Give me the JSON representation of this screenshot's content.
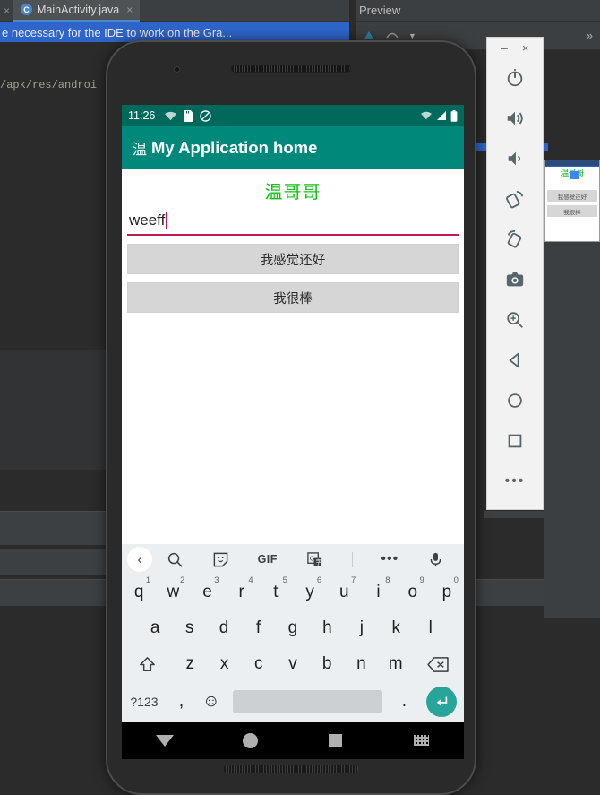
{
  "ide": {
    "tab_label": "MainActivity.java",
    "tab_icon": "class-java-icon",
    "tab_close": "×",
    "tab_close_left": "×",
    "preview_panel_title": "Preview",
    "overflow_label": "»",
    "highlighted_line": "e necessary for the IDE to work on the Gra...",
    "resource_path": "/apk/res/androi"
  },
  "mini_preview": {
    "green_text": "温哥哥",
    "button1": "我感觉还好",
    "button2": "我很棒"
  },
  "emulator_toolbar": {
    "minimize": "–",
    "close": "×",
    "buttons": [
      {
        "name": "power-icon",
        "label": "Power"
      },
      {
        "name": "volume-up-icon",
        "label": "Volume Up"
      },
      {
        "name": "volume-down-icon",
        "label": "Volume Down"
      },
      {
        "name": "rotate-left-icon",
        "label": "Rotate Left"
      },
      {
        "name": "rotate-right-icon",
        "label": "Rotate Right"
      },
      {
        "name": "screenshot-camera-icon",
        "label": "Take Screenshot"
      },
      {
        "name": "zoom-in-icon",
        "label": "Zoom"
      },
      {
        "name": "back-icon",
        "label": "Back"
      },
      {
        "name": "home-icon",
        "label": "Home"
      },
      {
        "name": "overview-icon",
        "label": "Overview"
      }
    ],
    "more_label": "•••"
  },
  "phone": {
    "statusbar": {
      "time": "11:26",
      "left_icons": [
        "wifi-off-icon",
        "sd-card-icon",
        "do-not-disturb-icon"
      ],
      "right_icons": [
        "wifi-off-icon",
        "signal-icon",
        "battery-icon"
      ]
    },
    "appbar": {
      "cn_prefix": "温",
      "title": "My Application home"
    },
    "content": {
      "green_text": "温哥哥",
      "input_value": "weeff",
      "input_placeholder": "",
      "button1": "我感觉还好",
      "button2": "我很棒"
    },
    "keyboard": {
      "toolbar": {
        "back": "‹",
        "search": "search-icon",
        "sticker": "sticker-icon",
        "gif": "GIF",
        "translate": "translate-icon",
        "more": "•••",
        "mic": "mic-icon"
      },
      "row1": [
        {
          "key": "q",
          "num": "1"
        },
        {
          "key": "w",
          "num": "2"
        },
        {
          "key": "e",
          "num": "3"
        },
        {
          "key": "r",
          "num": "4"
        },
        {
          "key": "t",
          "num": "5"
        },
        {
          "key": "y",
          "num": "6"
        },
        {
          "key": "u",
          "num": "7"
        },
        {
          "key": "i",
          "num": "8"
        },
        {
          "key": "o",
          "num": "9"
        },
        {
          "key": "p",
          "num": "0"
        }
      ],
      "row2": [
        "a",
        "s",
        "d",
        "f",
        "g",
        "h",
        "j",
        "k",
        "l"
      ],
      "row3": [
        "z",
        "x",
        "c",
        "v",
        "b",
        "n",
        "m"
      ],
      "shift": "shift-icon",
      "backspace": "backspace-icon",
      "row4": {
        "symbols": "?123",
        "comma": ",",
        "emoji": "☺",
        "space": "",
        "period": ".",
        "enter": "enter-icon"
      }
    },
    "navbar": {
      "back": "down-triangle-icon",
      "home": "circle-home-icon",
      "recents": "square-recents-icon",
      "switch_keyboard": "keyboard-switch-icon"
    }
  },
  "colors": {
    "status_bar": "#00695c",
    "app_bar": "#00897b",
    "green_text": "#14c214",
    "input_underline": "#c2185b",
    "button_bg": "#d6d6d6",
    "enter_key": "#26a69a",
    "ide_bg": "#2b2b2b",
    "ide_panel": "#3c3f41",
    "ide_highlight": "#2f65ca"
  }
}
